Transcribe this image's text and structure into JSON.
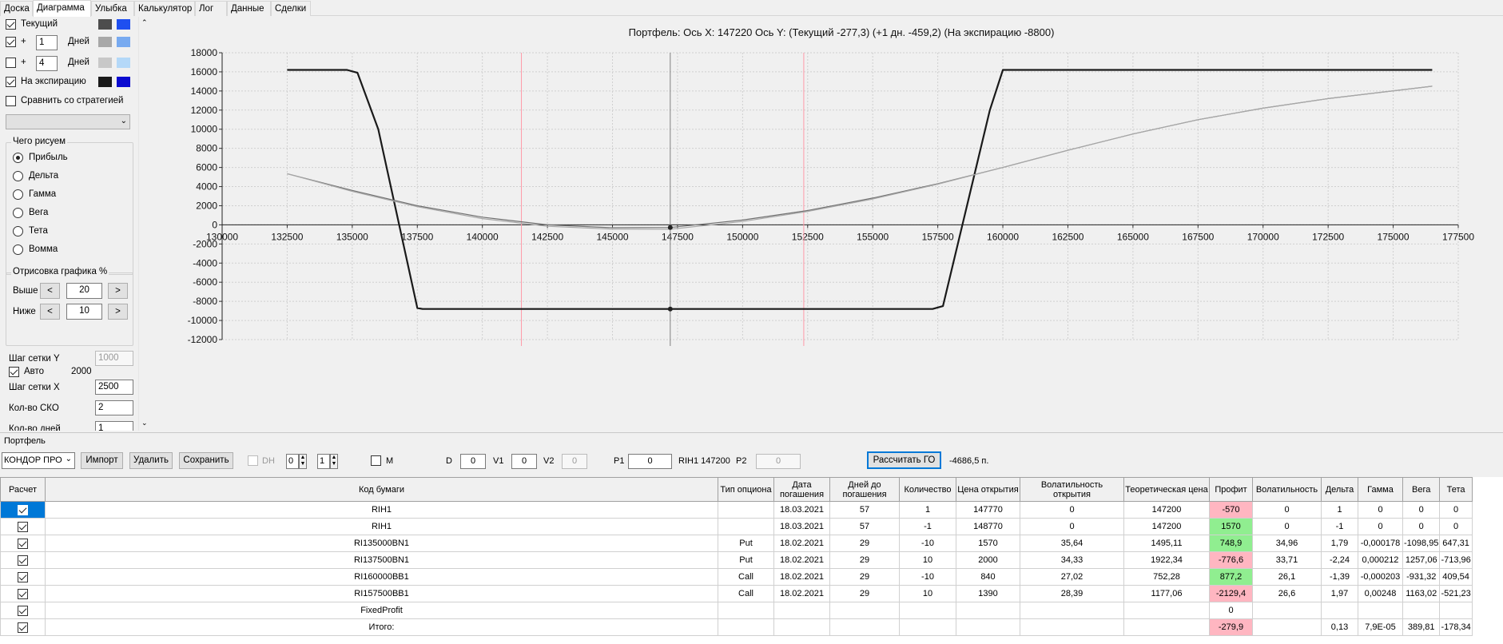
{
  "tabs": [
    "Доска",
    "Диаграмма",
    "Улыбка",
    "Калькулятор",
    "Лог",
    "Данные",
    "Сделки"
  ],
  "active_tab": 1,
  "left": {
    "current_label": "Текущий",
    "plus1": {
      "sign": "+",
      "value": "1",
      "unit": "Дней"
    },
    "plus2": {
      "sign": "+",
      "value": "4",
      "unit": "Дней"
    },
    "expiry_label": "На экспирацию",
    "compare_label": "Сравнить со стратегией",
    "draw_group": "Чего рисуем",
    "radios": [
      "Прибыль",
      "Дельта",
      "Гамма",
      "Вега",
      "Тета",
      "Вомма"
    ],
    "range_group": "Отрисовка графика %",
    "above_label": "Выше",
    "above_value": "20",
    "below_label": "Ниже",
    "below_value": "10",
    "prev": "<",
    "next": ">",
    "grid_y_label": "Шаг сетки Y",
    "grid_y_value": "1000",
    "auto_label": "Авто",
    "auto_value": "2000",
    "grid_x_label": "Шаг сетки X",
    "grid_x_value": "2500",
    "sko_label": "Кол-во СКО",
    "sko_value": "2",
    "days_label": "Кол-во дней",
    "days_value": "1"
  },
  "colors": {
    "current": [
      "#4d4d4d",
      "#1e4ff0"
    ],
    "plus1": [
      "#a8a8a8",
      "#78aaf0"
    ],
    "plus2": [
      "#c8c8c8",
      "#b4d8f8"
    ],
    "expiry": [
      "#1a1a1a",
      "#0a0ad0"
    ],
    "profit_neg": "#ffb6c1",
    "profit_pos": "#90ee90",
    "selection": "#0078d7"
  },
  "chart_data": {
    "type": "line",
    "title": "Портфель: Ось X: 147220 Ось Y:  (Текущий -277,3)  (+1 дн. -459,2)  (На экспирацию -8800)",
    "xlim": [
      130000,
      177500
    ],
    "ylim": [
      -12000,
      18000
    ],
    "x_ticks": [
      130000,
      132500,
      135000,
      137500,
      140000,
      142500,
      145000,
      147500,
      150000,
      152500,
      155000,
      157500,
      160000,
      162500,
      165000,
      167500,
      170000,
      172500,
      175000,
      177500
    ],
    "y_ticks": [
      18000,
      16000,
      14000,
      12000,
      10000,
      8000,
      6000,
      4000,
      2000,
      0,
      -2000,
      -4000,
      -6000,
      -8000,
      -10000,
      -12000
    ],
    "grid": true,
    "vlines": [
      {
        "x": 141500,
        "color": "#ff9aa8"
      },
      {
        "x": 152350,
        "color": "#ff9aa8"
      },
      {
        "x": 147220,
        "color": "#808080"
      }
    ],
    "series": [
      {
        "x": [
          132500,
          134800,
          135200,
          136000,
          137500,
          137700,
          157300,
          157700,
          159500,
          160000,
          176500
        ],
        "y": [
          16200,
          16200,
          15900,
          10000,
          -8700,
          -8800,
          -8800,
          -8500,
          12000,
          16200,
          16200
        ],
        "color": "#1a1a1a",
        "width": 2.2
      },
      {
        "x": [
          132500,
          135000,
          137500,
          140000,
          142500,
          145000,
          147220,
          150000,
          152500,
          155000,
          157500,
          160000,
          162500,
          165000,
          167500,
          170000,
          172500,
          176500
        ],
        "y": [
          5350,
          3600,
          2000,
          800,
          0,
          -300,
          -277,
          500,
          1500,
          2800,
          4300,
          6000,
          7800,
          9500,
          11000,
          12200,
          13200,
          14500
        ],
        "color": "#707070",
        "width": 1.2
      },
      {
        "x": [
          132500,
          135000,
          137500,
          140000,
          142500,
          145000,
          147220,
          150000,
          152500,
          155000,
          157500,
          160000,
          162500,
          165000,
          167500,
          170000,
          172500,
          176500
        ],
        "y": [
          5350,
          3500,
          1900,
          650,
          -150,
          -450,
          -459,
          350,
          1400,
          2700,
          4250,
          6000,
          7800,
          9500,
          11000,
          12200,
          13200,
          14500
        ],
        "color": "#a8a8a8",
        "width": 1.2
      }
    ],
    "markers": [
      {
        "x": 147220,
        "y": -8800
      },
      {
        "x": 147220,
        "y": -277
      }
    ]
  },
  "portfolio": {
    "label": "Портфель",
    "select_value": "КОНДОР ПРО",
    "import": "Импорт",
    "delete": "Удалить",
    "save": "Сохранить",
    "dh": "DH",
    "dh_a": "0",
    "dh_b": "1",
    "m": "M",
    "d_label": "D",
    "d_value": "0",
    "v1_label": "V1",
    "v1_value": "0",
    "v2_label": "V2",
    "v2_value": "0",
    "p1_label": "P1",
    "p1_value": "0",
    "ticker_price": "RIH1 147200",
    "p2_label": "P2",
    "p2_value": "0",
    "calc_go": "Рассчитать ГО",
    "go_value": "-4686,5 п."
  },
  "table": {
    "columns": [
      "Расчет",
      "Код бумаги",
      "Тип опциона",
      "Дата погашения",
      "Дней до погашения",
      "Количество",
      "Цена открытия",
      "Волатильность открытия",
      "Теоретическая цена",
      "Профит",
      "Волатильность",
      "Дельта",
      "Гамма",
      "Вега",
      "Тета"
    ],
    "rows": [
      [
        "",
        "RIH1",
        "",
        "18.03.2021",
        "57",
        "1",
        "147770",
        "0",
        "147200",
        "-570",
        "0",
        "1",
        "0",
        "0",
        "0"
      ],
      [
        "",
        "RIH1",
        "",
        "18.03.2021",
        "57",
        "-1",
        "148770",
        "0",
        "147200",
        "1570",
        "0",
        "-1",
        "0",
        "0",
        "0"
      ],
      [
        "",
        "RI135000BN1",
        "Put",
        "18.02.2021",
        "29",
        "-10",
        "1570",
        "35,64",
        "1495,11",
        "748,9",
        "34,96",
        "1,79",
        "-0,000178",
        "-1098,95",
        "647,31"
      ],
      [
        "",
        "RI137500BN1",
        "Put",
        "18.02.2021",
        "29",
        "10",
        "2000",
        "34,33",
        "1922,34",
        "-776,6",
        "33,71",
        "-2,24",
        "0,000212",
        "1257,06",
        "-713,96"
      ],
      [
        "",
        "RI160000BB1",
        "Call",
        "18.02.2021",
        "29",
        "-10",
        "840",
        "27,02",
        "752,28",
        "877,2",
        "26,1",
        "-1,39",
        "-0,000203",
        "-931,32",
        "409,54"
      ],
      [
        "",
        "RI157500BB1",
        "Call",
        "18.02.2021",
        "29",
        "10",
        "1390",
        "28,39",
        "1177,06",
        "-2129,4",
        "26,6",
        "1,97",
        "0,00248",
        "1163,02",
        "-521,23"
      ],
      [
        "",
        "FixedProfit",
        "",
        "",
        "",
        "",
        "",
        "",
        "",
        "0",
        "",
        "",
        "",
        "",
        ""
      ],
      [
        "",
        "Итого:",
        "",
        "",
        "",
        "",
        "",
        "",
        "",
        "-279,9",
        "",
        "0,13",
        "7,9E-05",
        "389,81",
        "-178,34"
      ]
    ]
  }
}
